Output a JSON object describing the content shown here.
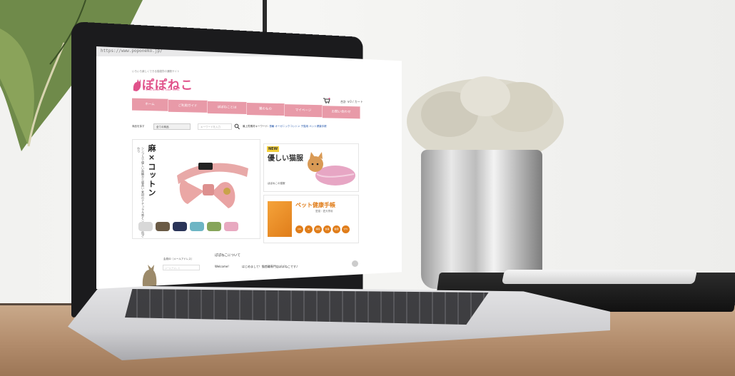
{
  "browser": {
    "url": "https://www.poponeko.jp/"
  },
  "site": {
    "tagline": "いろいろ楽しくできる猫雑貨の通販サイト",
    "logo": "ぽぽねこ",
    "logo_sub": "\"Look better for cats\" fruits.",
    "cart_label": "合計 ￥0 / カート",
    "nav": [
      "ホーム",
      "ご利用ガイド",
      "ぽぽねことは",
      "猫のもの",
      "マイページ",
      "お問い合わせ"
    ],
    "search": {
      "label": "商品を探す",
      "category": "全ての商品",
      "placeholder": "キーワードを入力",
      "popular_label": "最上質素材キーワード:",
      "popular_keywords": "首輪 オーガニックコットン 子猫用 ペット健康手帳"
    },
    "banner_main": {
      "title": "麻×コットン",
      "copy": "シンプルで優しい首輪から猫具い 素材のナチュラル感と ソフトな肌ざわり"
    },
    "banner_new": {
      "badge": "NEW",
      "title": "優しい猫服",
      "sub": "ぽぽねこの猫服"
    },
    "banner_book": {
      "title": "ペット健康手帳",
      "sub": "愛猫・愛犬専用",
      "dots": [
        "QR",
        "ID",
        "病院",
        "食事",
        "健康",
        "ﾜｸﾁﾝ"
      ]
    },
    "login": {
      "label": "会員ID（メールアドレス）",
      "email_placeholder": "メールアドレス"
    },
    "about": {
      "title": "ぽぽねこについて",
      "welcome": "Welcome!",
      "message": "はじめまして！猫首輪専門店ぽぽねこです♪"
    }
  },
  "colors": {
    "brand_pink": "#e0518a",
    "nav_pink": "#e89aa8",
    "book_orange": "#e07d1a"
  }
}
